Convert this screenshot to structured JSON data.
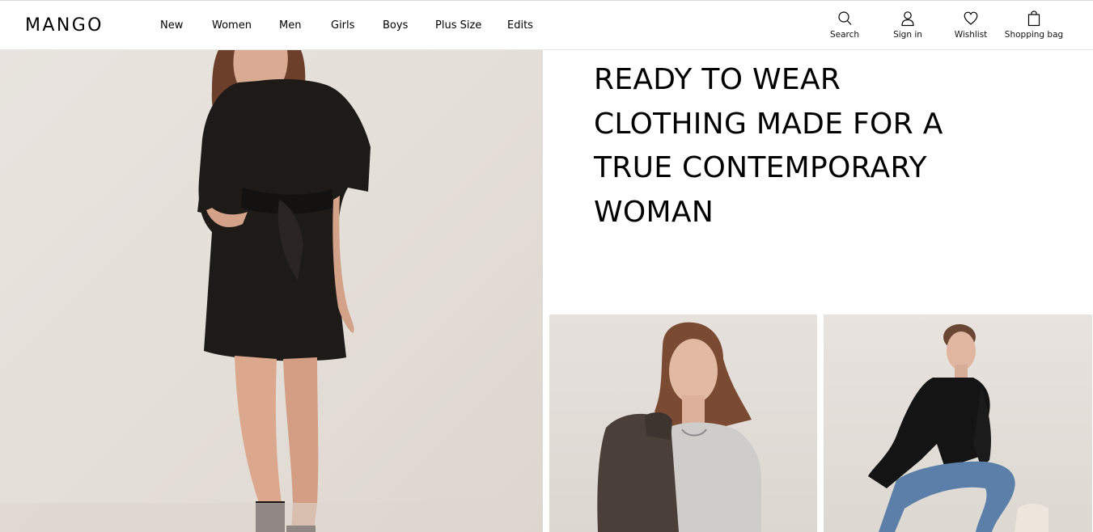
{
  "header": {
    "logo": "MANGO",
    "nav": [
      "New",
      "Women",
      "Men",
      "Girls",
      "Boys",
      "Plus Size",
      "Edits"
    ],
    "tools": {
      "search": {
        "label": "Search",
        "icon": "search-icon"
      },
      "signin": {
        "label": "Sign in",
        "icon": "user-icon"
      },
      "wishlist": {
        "label": "Wishlist",
        "icon": "heart-icon"
      },
      "bag": {
        "label": "Shopping bag",
        "icon": "bag-icon"
      }
    }
  },
  "main": {
    "headline": [
      "READY TO WEAR",
      "CLOTHING MADE FOR A",
      "TRUE CONTEMPORARY",
      "WOMAN"
    ]
  },
  "colors": {
    "text": "#000000",
    "background": "#ffffff",
    "image_backdrop": "#e6e1dc"
  }
}
